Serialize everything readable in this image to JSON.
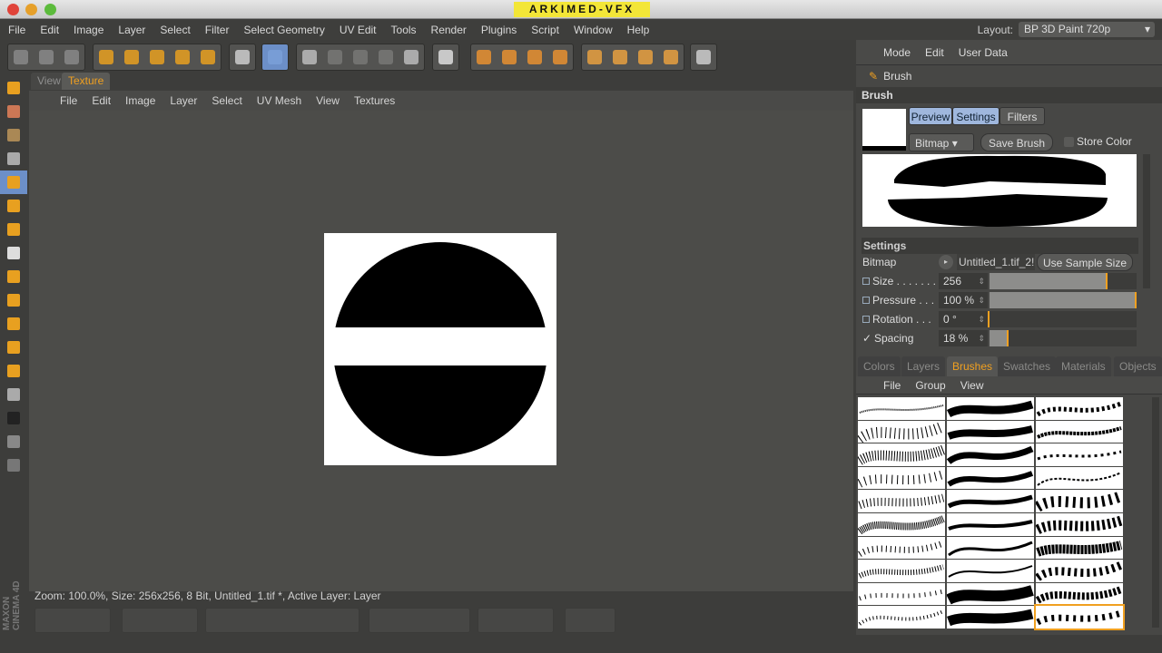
{
  "window": {
    "brand": "ARKIMED-VFX"
  },
  "menubar": [
    "File",
    "Edit",
    "Image",
    "Layer",
    "Select",
    "Filter",
    "Select Geometry",
    "UV Edit",
    "Tools",
    "Render",
    "Plugins",
    "Script",
    "Window",
    "Help"
  ],
  "layout": {
    "label": "Layout:",
    "value": "BP 3D Paint 720p"
  },
  "toolbar_groups": [
    {
      "icons": [
        "undo-icon",
        "redo-icon",
        "reload-texture-icon"
      ]
    },
    {
      "icons": [
        "live-selection-icon",
        "move-icon",
        "scale-icon",
        "rotate-icon",
        "lock-icon"
      ]
    },
    {
      "icons": [
        "paint-setup-icon"
      ]
    },
    {
      "icons": [
        "paint-3d-icon"
      ]
    },
    {
      "icons": [
        "projection-paint-icon",
        "uv-paint-icon",
        "uv-polygon-icon",
        "uv-points-icon",
        "texture-icon"
      ]
    },
    {
      "icons": [
        "render-icon"
      ]
    },
    {
      "icons": [
        "cube-texture-icon",
        "cube-uv-icon",
        "cube-points-icon",
        "checker-icon"
      ]
    },
    {
      "icons": [
        "object-mode-icon",
        "polygon-mode-icon",
        "edge-mode-icon",
        "point-mode-icon"
      ]
    },
    {
      "icons": [
        "viewport-icon"
      ]
    }
  ],
  "texture_panel": {
    "tabs": [
      "View",
      "Texture"
    ],
    "active_tab": "Texture",
    "menu": [
      "File",
      "Edit",
      "Image",
      "Layer",
      "Select",
      "UV Mesh",
      "View",
      "Textures"
    ],
    "status": "Zoom: 100.0%, Size: 256x256, 8 Bit, Untitled_1.tif *, Active Layer: Layer"
  },
  "attributes": {
    "menu": [
      "Mode",
      "Edit",
      "User Data"
    ],
    "object": "Brush",
    "section": "Brush",
    "seg_buttons": [
      "Preview",
      "Settings",
      "Filters"
    ],
    "type_select": "Bitmap",
    "save_brush": "Save Brush",
    "store_color": "Store Color",
    "settings_header": "Settings",
    "bitmap_label": "Bitmap",
    "bitmap_value": "Untitled_1.tif_2!",
    "use_sample_size": "Use Sample Size",
    "params": [
      {
        "label": "Size . . . . . . .",
        "value": "256",
        "fraction": 0.8,
        "checked": false
      },
      {
        "label": "Pressure . . .",
        "value": "100 %",
        "fraction": 1.0,
        "checked": false
      },
      {
        "label": "Rotation . . .",
        "value": "0 °",
        "fraction": 0.0,
        "checked": false
      },
      {
        "label": "Spacing",
        "value": "18 %",
        "fraction": 0.13,
        "checked": true
      }
    ]
  },
  "bottom_panel": {
    "tabs": [
      "Colors",
      "Layers",
      "Brushes",
      "Swatches",
      "Materials",
      "Objects"
    ],
    "active_tab": "Brushes",
    "menu": [
      "File",
      "Group",
      "View"
    ],
    "brush_count": 30
  },
  "side_label": "MAXON CINEMA 4D",
  "colors": {
    "accent": "#f0a020",
    "brand_yellow": "#f3e637"
  }
}
